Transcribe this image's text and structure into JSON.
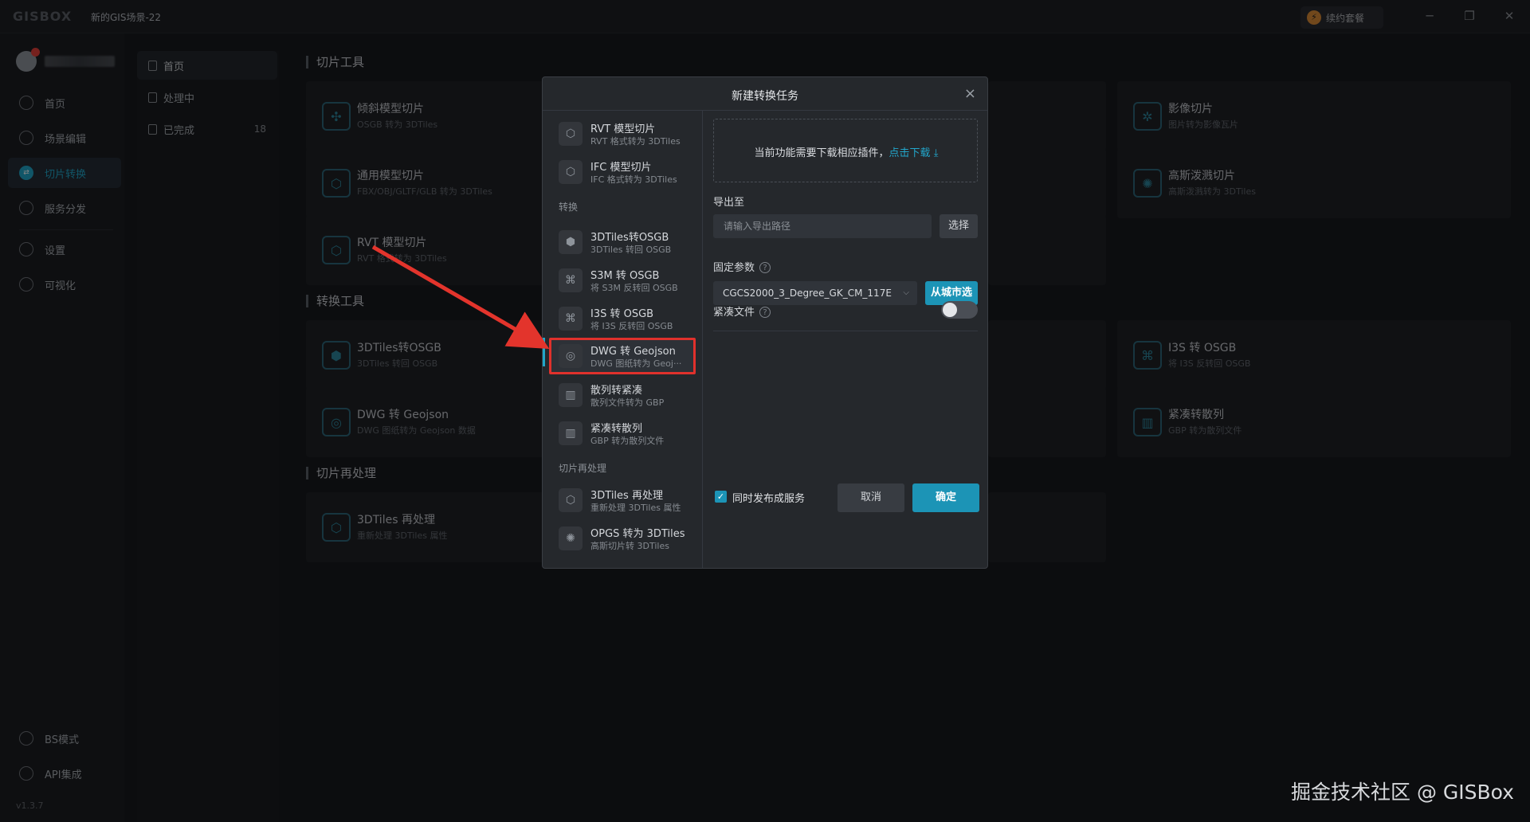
{
  "app": {
    "logo": "GISBOX",
    "scene_title": "新的GIS场景-22",
    "renew_label": "续约套餐",
    "renew_icon": "⚡",
    "version": "v1.3.7"
  },
  "window_controls": {
    "minimize": "─",
    "restore": "❐",
    "close": "✕"
  },
  "sidebar": {
    "items": [
      {
        "label": "首页",
        "icon": "home-icon"
      },
      {
        "label": "场景编辑",
        "icon": "scene-edit-icon"
      },
      {
        "label": "切片转换",
        "icon": "convert-icon",
        "active": true
      },
      {
        "label": "服务分发",
        "icon": "publish-icon"
      },
      {
        "label": "设置",
        "icon": "settings-icon"
      },
      {
        "label": "可视化",
        "icon": "visual-icon"
      }
    ],
    "bottom": [
      {
        "label": "BS模式",
        "icon": "code-icon"
      },
      {
        "label": "API集成",
        "icon": "link-icon"
      }
    ]
  },
  "subnav": {
    "items": [
      {
        "label": "首页",
        "active": true
      },
      {
        "label": "处理中"
      },
      {
        "label": "已完成",
        "count": "18"
      }
    ]
  },
  "sections": {
    "slicing": {
      "title": "切片工具",
      "cards": [
        {
          "title": "倾斜模型切片",
          "sub": "OSGB 转为 3DTiles"
        },
        {
          "title": "通用模型切片",
          "sub": "FBX/OBJ/GLTF/GLB 转为 3DTiles"
        },
        {
          "title": "RVT 模型切片",
          "sub": "RVT 格式转为 3DTiles"
        },
        {
          "title": "影像切片",
          "sub": "图片转为影像瓦片"
        },
        {
          "title": "高斯泼溅切片",
          "sub": "高斯泼溅转为 3DTiles"
        }
      ]
    },
    "conversion": {
      "title": "转换工具",
      "cards": [
        {
          "title": "3DTiles转OSGB",
          "sub": "3DTiles 转回 OSGB"
        },
        {
          "title": "DWG 转 Geojson",
          "sub": "DWG 图纸转为 Geojson 数据"
        },
        {
          "title": "I3S 转 OSGB",
          "sub": "将 I3S 反转回 OSGB"
        },
        {
          "title": "紧凑转散列",
          "sub": "GBP 转为散列文件"
        }
      ]
    },
    "reprocess": {
      "title": "切片再处理",
      "cards": [
        {
          "title": "3DTiles 再处理",
          "sub": "重新处理 3DTiles 属性"
        }
      ]
    }
  },
  "modal": {
    "title": "新建转换任务",
    "close": "×",
    "list": {
      "top_items": [
        {
          "title": "RVT 模型切片",
          "sub": "RVT 格式转为 3DTiles"
        },
        {
          "title": "IFC 模型切片",
          "sub": "IFC 格式转为 3DTiles"
        }
      ],
      "group_convert": "转换",
      "convert_items": [
        {
          "title": "3DTiles转OSGB",
          "sub": "3DTiles 转回 OSGB"
        },
        {
          "title": "S3M 转 OSGB",
          "sub": "将 S3M 反转回 OSGB"
        },
        {
          "title": "I3S 转 OSGB",
          "sub": "将 I3S 反转回 OSGB"
        },
        {
          "title": "DWG 转 Geojson",
          "sub": "DWG 图纸转为 Geoj···",
          "selected": true
        },
        {
          "title": "散列转紧凑",
          "sub": "散列文件转为 GBP"
        },
        {
          "title": "紧凑转散列",
          "sub": "GBP 转为散列文件"
        }
      ],
      "group_reprocess": "切片再处理",
      "reprocess_items": [
        {
          "title": "3DTiles 再处理",
          "sub": "重新处理 3DTiles 属性"
        },
        {
          "title": "OPGS 转为 3DTiles",
          "sub": "高斯切片转 3DTiles"
        }
      ]
    },
    "form": {
      "plugin_notice": "当前功能需要下载相应插件，",
      "plugin_link": "点击下载",
      "export_label": "导出至",
      "export_placeholder": "请输入导出路径",
      "choose_label": "选择",
      "fixed_params_label": "固定参数",
      "crs_value": "CGCS2000_3_Degree_GK_CM_117E",
      "crs_caret": "⌵",
      "city_btn": "从城市选",
      "compact_label": "紧凑文件",
      "compact_on": false,
      "help": "?",
      "publish_label": "同时发布成服务",
      "publish_checked": true,
      "check_mark": "✓",
      "cancel": "取消",
      "ok": "确定"
    }
  },
  "watermark": "掘金技术社区 @ GISBox",
  "colors": {
    "accent": "#1c94b6",
    "highlight": "#e0312c",
    "background": "#17191d"
  }
}
